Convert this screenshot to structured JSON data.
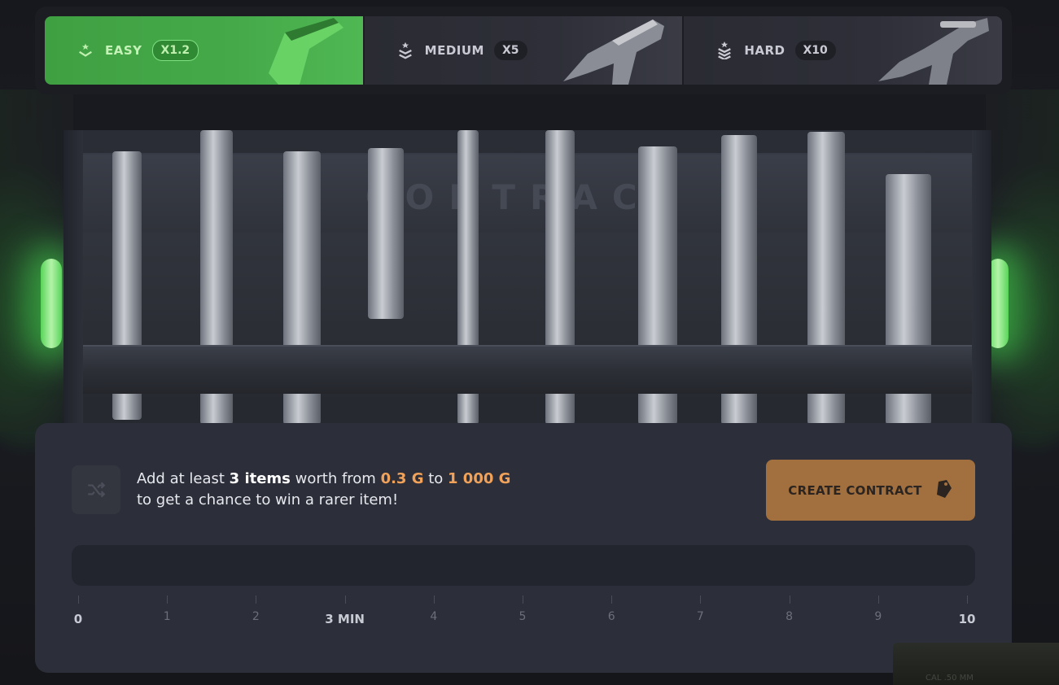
{
  "difficulty_tabs": [
    {
      "label": "EASY",
      "multiplier": "X1.2",
      "active": true,
      "icon": "rank-chevron-icon"
    },
    {
      "label": "MEDIUM",
      "multiplier": "X5",
      "active": false,
      "icon": "rank-double-chevron-icon"
    },
    {
      "label": "HARD",
      "multiplier": "X10",
      "active": false,
      "icon": "rank-triple-chevron-icon"
    }
  ],
  "rack": {
    "title": "CONTRACT"
  },
  "contract": {
    "line1_prefix": "Add at least ",
    "line1_items": "3 items",
    "line1_mid": " worth from ",
    "min_value": "0.3 G",
    "line1_to": " to ",
    "max_value": "1 000 G",
    "line2": "to get a chance to win a rarer item!",
    "create_label": "CREATE CONTRACT",
    "progress_value": 0
  },
  "timeline": {
    "ticks": [
      "0",
      "1",
      "2",
      "3 MIN",
      "4",
      "5",
      "6",
      "7",
      "8",
      "9",
      "10"
    ],
    "major": [
      "0",
      "3 MIN",
      "10"
    ]
  },
  "ammo_box": {
    "label": "CAL .50 MM"
  },
  "colors": {
    "accent_green": "#45a949",
    "gold": "#f0a25a",
    "button_bronze": "#a2703e",
    "panel_bg": "#2c2e39"
  }
}
